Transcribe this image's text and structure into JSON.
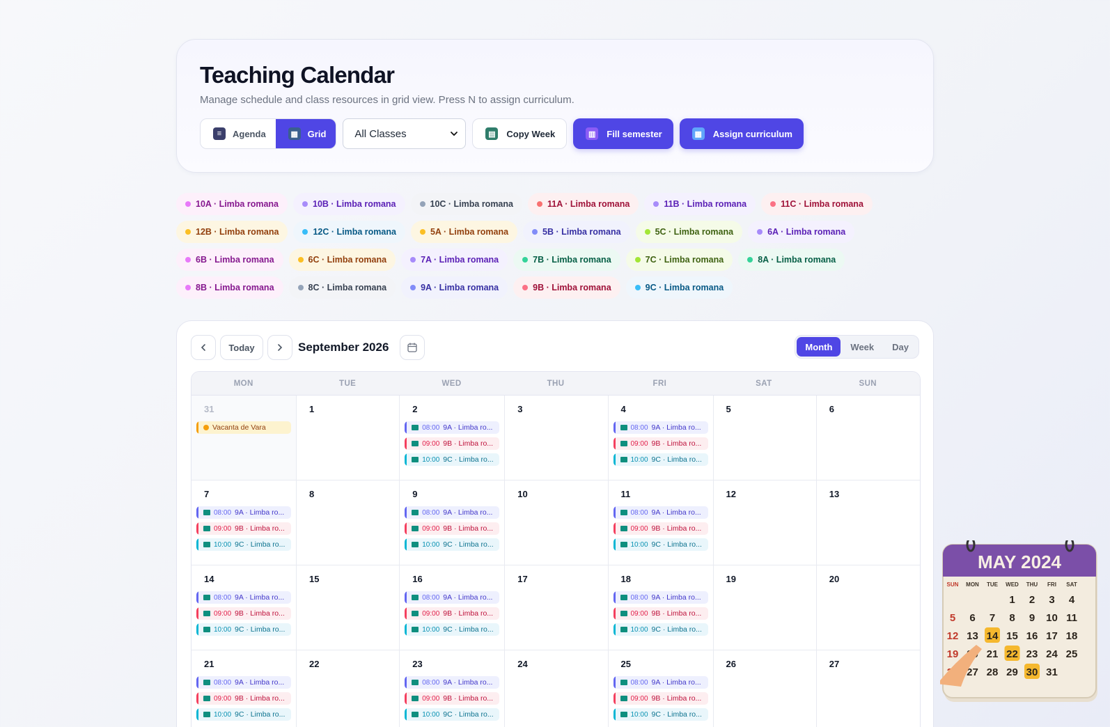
{
  "header": {
    "title": "Teaching Calendar",
    "subtitle": "Manage schedule and class resources in grid view. Press N to assign curriculum.",
    "view_toggle": [
      {
        "label": "Agenda",
        "active": false
      },
      {
        "label": "Grid",
        "active": true
      }
    ],
    "class_select": {
      "value": "All Classes"
    },
    "copy_week_label": "Copy Week",
    "fill_semester_label": "Fill semester",
    "assign_curriculum_label": "Assign curriculum"
  },
  "chips": [
    [
      {
        "label": "10A · Limba romana",
        "dot": "#e879f9",
        "bg": "#fdf0fb",
        "fg": "#86198f"
      },
      {
        "label": "10B · Limba romana",
        "dot": "#a78bfa",
        "bg": "#f4f1fe",
        "fg": "#5b21b6"
      },
      {
        "label": "10C · Limba romana",
        "dot": "#94a3b8",
        "bg": "#f3f4f7",
        "fg": "#374151"
      },
      {
        "label": "11A · Limba romana",
        "dot": "#f87171",
        "bg": "#fdf0f1",
        "fg": "#9f1239"
      },
      {
        "label": "11B · Limba romana",
        "dot": "#a78bfa",
        "bg": "#f4f1fe",
        "fg": "#5b21b6"
      },
      {
        "label": "11C · Limba romana",
        "dot": "#fb7185",
        "bg": "#fdf0f1",
        "fg": "#9f1239"
      }
    ],
    [
      {
        "label": "12B · Limba romana",
        "dot": "#fbbf24",
        "bg": "#fdf6e2",
        "fg": "#92400e"
      },
      {
        "label": "12C · Limba romana",
        "dot": "#38bdf8",
        "bg": "#eff6fc",
        "fg": "#075985"
      },
      {
        "label": "5A · Limba romana",
        "dot": "#fbbf24",
        "bg": "#fdf6e2",
        "fg": "#92400e"
      },
      {
        "label": "5B · Limba romana",
        "dot": "#818cf8",
        "bg": "#f1f2fd",
        "fg": "#3730a3"
      },
      {
        "label": "5C · Limba romana",
        "dot": "#a3e635",
        "bg": "#f5fbe8",
        "fg": "#3f6212"
      },
      {
        "label": "6A · Limba romana",
        "dot": "#a78bfa",
        "bg": "#f4f1fe",
        "fg": "#5b21b6"
      }
    ],
    [
      {
        "label": "6B · Limba romana",
        "dot": "#e879f9",
        "bg": "#fdf0fb",
        "fg": "#86198f"
      },
      {
        "label": "6C · Limba romana",
        "dot": "#fbbf24",
        "bg": "#fdf6e2",
        "fg": "#92400e"
      },
      {
        "label": "7A · Limba romana",
        "dot": "#a78bfa",
        "bg": "#f4f1fe",
        "fg": "#5b21b6"
      },
      {
        "label": "7B · Limba romana",
        "dot": "#34d399",
        "bg": "#ecf9f3",
        "fg": "#065f46"
      },
      {
        "label": "7C · Limba romana",
        "dot": "#a3e635",
        "bg": "#f5fbe8",
        "fg": "#3f6212"
      },
      {
        "label": "8A · Limba romana",
        "dot": "#34d399",
        "bg": "#ecf9f3",
        "fg": "#065f46"
      }
    ],
    [
      {
        "label": "8B · Limba romana",
        "dot": "#e879f9",
        "bg": "#fdf0fb",
        "fg": "#86198f"
      },
      {
        "label": "8C · Limba romana",
        "dot": "#94a3b8",
        "bg": "#f3f4f7",
        "fg": "#374151"
      },
      {
        "label": "9A · Limba romana",
        "dot": "#818cf8",
        "bg": "#f1f2fd",
        "fg": "#3730a3"
      },
      {
        "label": "9B · Limba romana",
        "dot": "#fb7185",
        "bg": "#fdf0f1",
        "fg": "#9f1239"
      },
      {
        "label": "9C · Limba romana",
        "dot": "#38bdf8",
        "bg": "#eff6fc",
        "fg": "#075985"
      }
    ]
  ],
  "calendar": {
    "today_label": "Today",
    "month_title": "September 2026",
    "views": [
      {
        "label": "Month",
        "active": true
      },
      {
        "label": "Week",
        "active": false
      },
      {
        "label": "Day",
        "active": false
      }
    ],
    "weekdays": [
      "MON",
      "TUE",
      "WED",
      "THU",
      "FRI",
      "SAT",
      "SUN"
    ],
    "weeks": [
      [
        {
          "day": "31",
          "muted": true,
          "events": [
            {
              "kind": "holiday",
              "title": "Vacanta de Vara"
            }
          ]
        },
        {
          "day": "1",
          "events": []
        },
        {
          "day": "2",
          "events": [
            {
              "kind": "a",
              "time": "08:00",
              "title": "9A · Limba ro..."
            },
            {
              "kind": "b",
              "time": "09:00",
              "title": "9B · Limba ro..."
            },
            {
              "kind": "c",
              "time": "10:00",
              "title": "9C · Limba ro..."
            }
          ]
        },
        {
          "day": "3",
          "events": []
        },
        {
          "day": "4",
          "events": [
            {
              "kind": "a",
              "time": "08:00",
              "title": "9A · Limba ro..."
            },
            {
              "kind": "b",
              "time": "09:00",
              "title": "9B · Limba ro..."
            },
            {
              "kind": "c",
              "time": "10:00",
              "title": "9C · Limba ro..."
            }
          ]
        },
        {
          "day": "5",
          "events": []
        },
        {
          "day": "6",
          "events": []
        }
      ],
      [
        {
          "day": "7",
          "events": [
            {
              "kind": "a",
              "time": "08:00",
              "title": "9A · Limba ro..."
            },
            {
              "kind": "b",
              "time": "09:00",
              "title": "9B · Limba ro..."
            },
            {
              "kind": "c",
              "time": "10:00",
              "title": "9C · Limba ro..."
            }
          ]
        },
        {
          "day": "8",
          "events": []
        },
        {
          "day": "9",
          "events": [
            {
              "kind": "a",
              "time": "08:00",
              "title": "9A · Limba ro..."
            },
            {
              "kind": "b",
              "time": "09:00",
              "title": "9B · Limba ro..."
            },
            {
              "kind": "c",
              "time": "10:00",
              "title": "9C · Limba ro..."
            }
          ]
        },
        {
          "day": "10",
          "events": []
        },
        {
          "day": "11",
          "events": [
            {
              "kind": "a",
              "time": "08:00",
              "title": "9A · Limba ro..."
            },
            {
              "kind": "b",
              "time": "09:00",
              "title": "9B · Limba ro..."
            },
            {
              "kind": "c",
              "time": "10:00",
              "title": "9C · Limba ro..."
            }
          ]
        },
        {
          "day": "12",
          "events": []
        },
        {
          "day": "13",
          "events": []
        }
      ],
      [
        {
          "day": "14",
          "events": [
            {
              "kind": "a",
              "time": "08:00",
              "title": "9A · Limba ro..."
            },
            {
              "kind": "b",
              "time": "09:00",
              "title": "9B · Limba ro..."
            },
            {
              "kind": "c",
              "time": "10:00",
              "title": "9C · Limba ro..."
            }
          ]
        },
        {
          "day": "15",
          "events": []
        },
        {
          "day": "16",
          "events": [
            {
              "kind": "a",
              "time": "08:00",
              "title": "9A · Limba ro..."
            },
            {
              "kind": "b",
              "time": "09:00",
              "title": "9B · Limba ro..."
            },
            {
              "kind": "c",
              "time": "10:00",
              "title": "9C · Limba ro..."
            }
          ]
        },
        {
          "day": "17",
          "events": []
        },
        {
          "day": "18",
          "events": [
            {
              "kind": "a",
              "time": "08:00",
              "title": "9A · Limba ro..."
            },
            {
              "kind": "b",
              "time": "09:00",
              "title": "9B · Limba ro..."
            },
            {
              "kind": "c",
              "time": "10:00",
              "title": "9C · Limba ro..."
            }
          ]
        },
        {
          "day": "19",
          "events": []
        },
        {
          "day": "20",
          "events": []
        }
      ],
      [
        {
          "day": "21",
          "events": [
            {
              "kind": "a",
              "time": "08:00",
              "title": "9A · Limba ro..."
            },
            {
              "kind": "b",
              "time": "09:00",
              "title": "9B · Limba ro..."
            },
            {
              "kind": "c",
              "time": "10:00",
              "title": "9C · Limba ro..."
            }
          ]
        },
        {
          "day": "22",
          "events": []
        },
        {
          "day": "23",
          "events": [
            {
              "kind": "a",
              "time": "08:00",
              "title": "9A · Limba ro..."
            },
            {
              "kind": "b",
              "time": "09:00",
              "title": "9B · Limba ro..."
            },
            {
              "kind": "c",
              "time": "10:00",
              "title": "9C · Limba ro..."
            }
          ]
        },
        {
          "day": "24",
          "events": []
        },
        {
          "day": "25",
          "events": [
            {
              "kind": "a",
              "time": "08:00",
              "title": "9A · Limba ro..."
            },
            {
              "kind": "b",
              "time": "09:00",
              "title": "9B · Limba ro..."
            },
            {
              "kind": "c",
              "time": "10:00",
              "title": "9C · Limba ro..."
            }
          ]
        },
        {
          "day": "26",
          "events": []
        },
        {
          "day": "27",
          "events": []
        }
      ]
    ]
  },
  "illustration": {
    "title": "MAY 2024",
    "weekdays": [
      "SUN",
      "MON",
      "TUE",
      "WED",
      "THU",
      "FRI",
      "SAT"
    ],
    "rows": [
      [
        "",
        "",
        "",
        "1",
        "2",
        "3",
        "4"
      ],
      [
        "5",
        "6",
        "7",
        "8",
        "9",
        "10",
        "11"
      ],
      [
        "12",
        "13",
        "14",
        "15",
        "16",
        "17",
        "18"
      ],
      [
        "19",
        "20",
        "21",
        "22",
        "23",
        "24",
        "25"
      ],
      [
        "26",
        "27",
        "28",
        "29",
        "30",
        "31",
        ""
      ]
    ],
    "highlighted": [
      "14",
      "22",
      "30"
    ]
  }
}
